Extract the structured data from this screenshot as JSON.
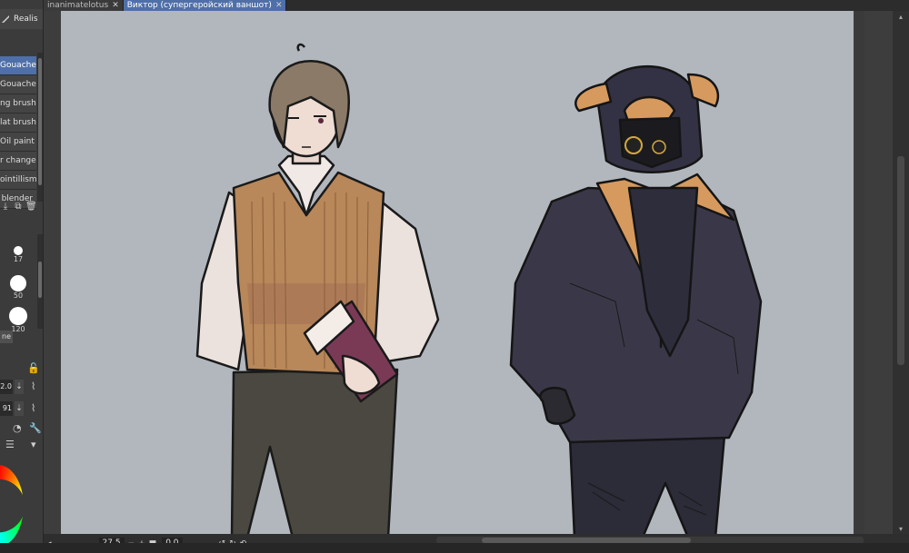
{
  "tabs": [
    {
      "label": "inanimatelotus",
      "active": false
    },
    {
      "label": "Виктор (супергеройский ваншот)",
      "active": true
    }
  ],
  "tool": {
    "label": "Realis",
    "icon": "brush-icon"
  },
  "subtools": [
    {
      "label": "Gouache",
      "selected": true
    },
    {
      "label": "Gouache",
      "selected": false
    },
    {
      "label": "ng brush",
      "selected": false
    },
    {
      "label": "lat brush",
      "selected": false
    },
    {
      "label": "Oil paint",
      "selected": false
    },
    {
      "label": "r change",
      "selected": false
    },
    {
      "label": "ointillism",
      "selected": false
    },
    {
      "label": "blender",
      "selected": false
    }
  ],
  "brush_sizes": [
    "17",
    "50",
    "120"
  ],
  "panel_tab_label": "ne",
  "properties": {
    "size_value": "2.0",
    "opacity_value": "91"
  },
  "status": {
    "zoom": "27.5",
    "rotation": "0.0"
  },
  "colors": {
    "canvas_bg": "#b2b7be",
    "accent": "#4f6fa8",
    "vest": "#b8875a",
    "hoodie": "#3a3848",
    "hoodie_lining": "#d69a5e"
  }
}
